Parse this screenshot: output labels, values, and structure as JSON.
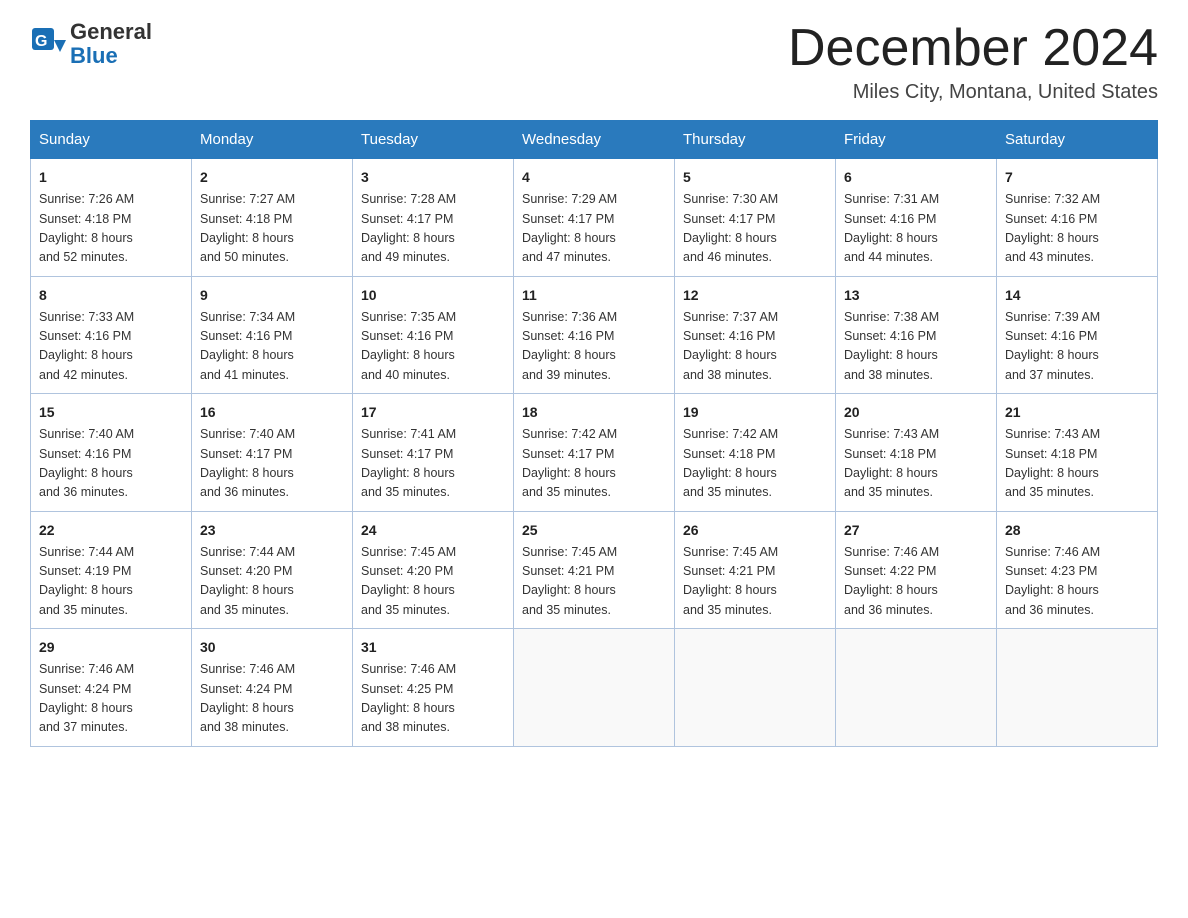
{
  "header": {
    "logo_line1": "General",
    "logo_line2": "Blue",
    "month_title": "December 2024",
    "location": "Miles City, Montana, United States"
  },
  "days_of_week": [
    "Sunday",
    "Monday",
    "Tuesday",
    "Wednesday",
    "Thursday",
    "Friday",
    "Saturday"
  ],
  "weeks": [
    [
      {
        "day": "1",
        "sunrise": "7:26 AM",
        "sunset": "4:18 PM",
        "daylight": "8 hours and 52 minutes."
      },
      {
        "day": "2",
        "sunrise": "7:27 AM",
        "sunset": "4:18 PM",
        "daylight": "8 hours and 50 minutes."
      },
      {
        "day": "3",
        "sunrise": "7:28 AM",
        "sunset": "4:17 PM",
        "daylight": "8 hours and 49 minutes."
      },
      {
        "day": "4",
        "sunrise": "7:29 AM",
        "sunset": "4:17 PM",
        "daylight": "8 hours and 47 minutes."
      },
      {
        "day": "5",
        "sunrise": "7:30 AM",
        "sunset": "4:17 PM",
        "daylight": "8 hours and 46 minutes."
      },
      {
        "day": "6",
        "sunrise": "7:31 AM",
        "sunset": "4:16 PM",
        "daylight": "8 hours and 44 minutes."
      },
      {
        "day": "7",
        "sunrise": "7:32 AM",
        "sunset": "4:16 PM",
        "daylight": "8 hours and 43 minutes."
      }
    ],
    [
      {
        "day": "8",
        "sunrise": "7:33 AM",
        "sunset": "4:16 PM",
        "daylight": "8 hours and 42 minutes."
      },
      {
        "day": "9",
        "sunrise": "7:34 AM",
        "sunset": "4:16 PM",
        "daylight": "8 hours and 41 minutes."
      },
      {
        "day": "10",
        "sunrise": "7:35 AM",
        "sunset": "4:16 PM",
        "daylight": "8 hours and 40 minutes."
      },
      {
        "day": "11",
        "sunrise": "7:36 AM",
        "sunset": "4:16 PM",
        "daylight": "8 hours and 39 minutes."
      },
      {
        "day": "12",
        "sunrise": "7:37 AM",
        "sunset": "4:16 PM",
        "daylight": "8 hours and 38 minutes."
      },
      {
        "day": "13",
        "sunrise": "7:38 AM",
        "sunset": "4:16 PM",
        "daylight": "8 hours and 38 minutes."
      },
      {
        "day": "14",
        "sunrise": "7:39 AM",
        "sunset": "4:16 PM",
        "daylight": "8 hours and 37 minutes."
      }
    ],
    [
      {
        "day": "15",
        "sunrise": "7:40 AM",
        "sunset": "4:16 PM",
        "daylight": "8 hours and 36 minutes."
      },
      {
        "day": "16",
        "sunrise": "7:40 AM",
        "sunset": "4:17 PM",
        "daylight": "8 hours and 36 minutes."
      },
      {
        "day": "17",
        "sunrise": "7:41 AM",
        "sunset": "4:17 PM",
        "daylight": "8 hours and 35 minutes."
      },
      {
        "day": "18",
        "sunrise": "7:42 AM",
        "sunset": "4:17 PM",
        "daylight": "8 hours and 35 minutes."
      },
      {
        "day": "19",
        "sunrise": "7:42 AM",
        "sunset": "4:18 PM",
        "daylight": "8 hours and 35 minutes."
      },
      {
        "day": "20",
        "sunrise": "7:43 AM",
        "sunset": "4:18 PM",
        "daylight": "8 hours and 35 minutes."
      },
      {
        "day": "21",
        "sunrise": "7:43 AM",
        "sunset": "4:18 PM",
        "daylight": "8 hours and 35 minutes."
      }
    ],
    [
      {
        "day": "22",
        "sunrise": "7:44 AM",
        "sunset": "4:19 PM",
        "daylight": "8 hours and 35 minutes."
      },
      {
        "day": "23",
        "sunrise": "7:44 AM",
        "sunset": "4:20 PM",
        "daylight": "8 hours and 35 minutes."
      },
      {
        "day": "24",
        "sunrise": "7:45 AM",
        "sunset": "4:20 PM",
        "daylight": "8 hours and 35 minutes."
      },
      {
        "day": "25",
        "sunrise": "7:45 AM",
        "sunset": "4:21 PM",
        "daylight": "8 hours and 35 minutes."
      },
      {
        "day": "26",
        "sunrise": "7:45 AM",
        "sunset": "4:21 PM",
        "daylight": "8 hours and 35 minutes."
      },
      {
        "day": "27",
        "sunrise": "7:46 AM",
        "sunset": "4:22 PM",
        "daylight": "8 hours and 36 minutes."
      },
      {
        "day": "28",
        "sunrise": "7:46 AM",
        "sunset": "4:23 PM",
        "daylight": "8 hours and 36 minutes."
      }
    ],
    [
      {
        "day": "29",
        "sunrise": "7:46 AM",
        "sunset": "4:24 PM",
        "daylight": "8 hours and 37 minutes."
      },
      {
        "day": "30",
        "sunrise": "7:46 AM",
        "sunset": "4:24 PM",
        "daylight": "8 hours and 38 minutes."
      },
      {
        "day": "31",
        "sunrise": "7:46 AM",
        "sunset": "4:25 PM",
        "daylight": "8 hours and 38 minutes."
      },
      null,
      null,
      null,
      null
    ]
  ],
  "labels": {
    "sunrise_prefix": "Sunrise: ",
    "sunset_prefix": "Sunset: ",
    "daylight_prefix": "Daylight: "
  }
}
